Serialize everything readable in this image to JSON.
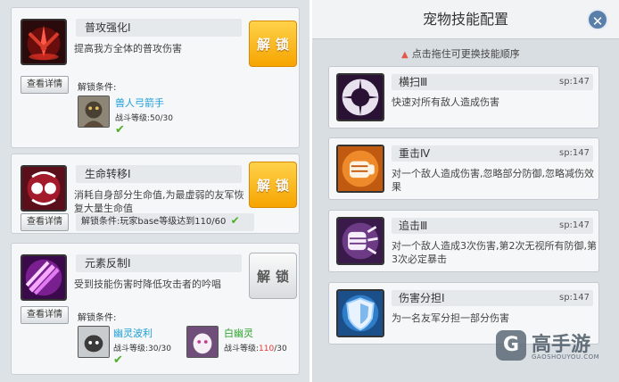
{
  "left_skills": [
    {
      "name": "普攻强化Ⅰ",
      "desc": "提高我方全体的普攻伤害",
      "unlock": "解锁",
      "detail": "查看详情",
      "cond_title": "解锁条件:",
      "requirements": [
        {
          "name": "兽人弓箭手",
          "lv_label": "战斗等级:",
          "lv_cur": "50",
          "lv_max": "/30",
          "met": true
        }
      ]
    },
    {
      "name": "生命转移Ⅰ",
      "desc": "消耗自身部分生命值,为最虚弱的友军恢复大量生命值",
      "unlock": "解锁",
      "detail": "查看详情",
      "cond": "解锁条件:玩家base等级达到110/60"
    },
    {
      "name": "元素反制Ⅰ",
      "desc": "受到技能伤害时降低攻击者的吟唱",
      "unlock": "解锁",
      "detail": "查看详情",
      "cond_title": "解锁条件:",
      "requirements": [
        {
          "name": "幽灵波利",
          "lv_label": "战斗等级:",
          "lv_cur": "30",
          "lv_max": "/30",
          "met": true
        },
        {
          "name": "白幽灵",
          "lv_label": "战斗等级:",
          "lv_cur": "110",
          "lv_max": "/30",
          "met": false
        }
      ]
    }
  ],
  "right": {
    "title": "宠物技能配置",
    "close": "✕",
    "hint": "点击拖住可更换技能顺序",
    "skills": [
      {
        "name": "横扫Ⅲ",
        "sp": "sp:147",
        "desc": "快速对所有敌人造成伤害"
      },
      {
        "name": "重击Ⅳ",
        "sp": "sp:147",
        "desc": "对一个敌人造成伤害,忽略部分防御,忽略减伤效果"
      },
      {
        "name": "追击Ⅲ",
        "sp": "sp:147",
        "desc": "对一个敌人造成3次伤害,第2次无视所有防御,第3次必定暴击"
      },
      {
        "name": "伤害分担Ⅰ",
        "sp": "sp:147",
        "desc": "为一名友军分担一部分伤害"
      }
    ]
  },
  "watermark": {
    "logo": "G",
    "text": "高手游",
    "sub": "GAOSHOUYOU.COM"
  },
  "check_mark": "✔",
  "colors": {
    "gold_button": "#f6a400",
    "cyan_name": "#1ea0d8",
    "green_name": "#2fa52f",
    "warn": "#e33333"
  }
}
